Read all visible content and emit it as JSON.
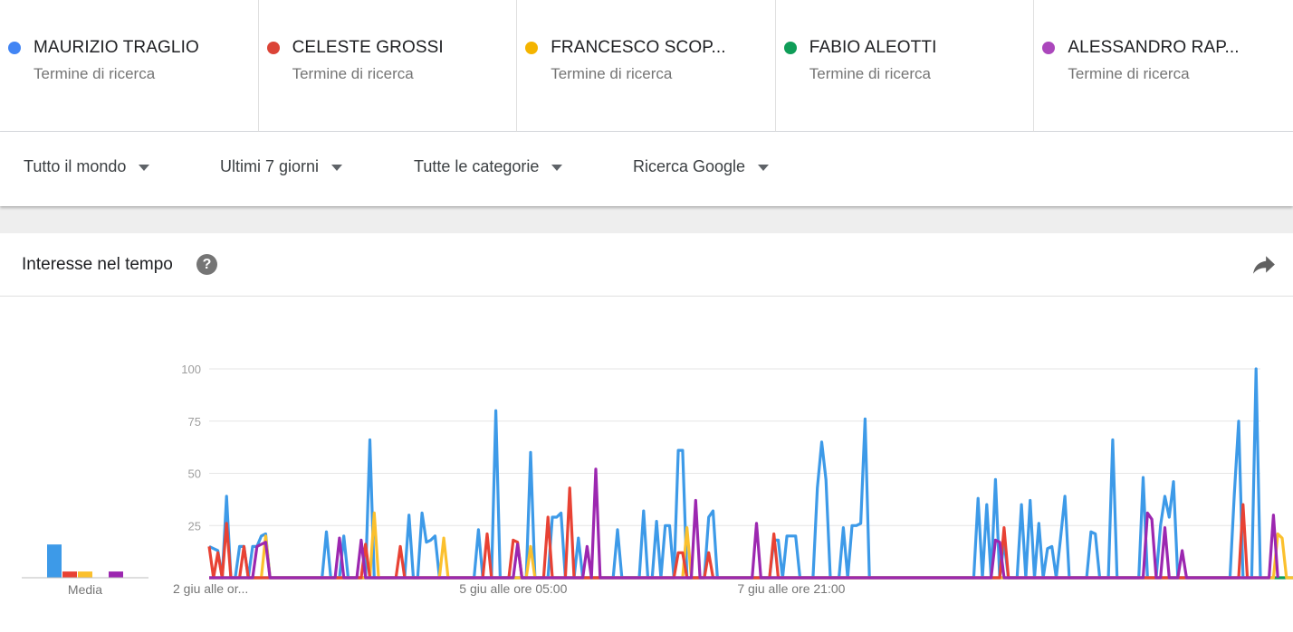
{
  "terms": [
    {
      "name": "MAURIZIO TRAGLIO",
      "subtitle": "Termine di ricerca",
      "color": "#4285f4"
    },
    {
      "name": "CELESTE GROSSI",
      "subtitle": "Termine di ricerca",
      "color": "#db4437"
    },
    {
      "name": "FRANCESCO SCOP...",
      "subtitle": "Termine di ricerca",
      "color": "#f4b400"
    },
    {
      "name": "FABIO ALEOTTI",
      "subtitle": "Termine di ricerca",
      "color": "#0f9d58"
    },
    {
      "name": "ALESSANDRO RAP...",
      "subtitle": "Termine di ricerca",
      "color": "#ab47bc"
    }
  ],
  "filters": {
    "region": "Tutto il mondo",
    "time": "Ultimi 7 giorni",
    "category": "Tutte le categorie",
    "property": "Ricerca Google"
  },
  "card": {
    "title": "Interesse nel tempo",
    "help_glyph": "?"
  },
  "chart_data": {
    "type": "line",
    "ylim": [
      0,
      100
    ],
    "y_ticks": [
      "100",
      "75",
      "50",
      "25"
    ],
    "x_labels": [
      {
        "label": "2 giu alle or...",
        "index": 0
      },
      {
        "label": "5 giu alle ore 05:00",
        "index": 70
      },
      {
        "label": "7 giu alle ore 21:00",
        "index": 134
      }
    ],
    "average_label": "Media",
    "averages": [
      {
        "name": "MAURIZIO TRAGLIO",
        "value": 16,
        "color": "#3d9ae8"
      },
      {
        "name": "CELESTE GROSSI",
        "value": 3,
        "color": "#e84234"
      },
      {
        "name": "FRANCESCO SCOP...",
        "value": 3,
        "color": "#fbc02d"
      },
      {
        "name": "FABIO ALEOTTI",
        "value": 0,
        "color": "#0f9d58"
      },
      {
        "name": "ALESSANDRO RAP...",
        "value": 3,
        "color": "#9c27b0"
      }
    ],
    "grid": true,
    "series": [
      {
        "name": "MAURIZIO TRAGLIO",
        "color": "#3d9ae8",
        "values": [
          15,
          14,
          13,
          0,
          39,
          0,
          0,
          15,
          15,
          0,
          15,
          15,
          20,
          21,
          0,
          0,
          0,
          0,
          0,
          0,
          0,
          0,
          0,
          0,
          0,
          0,
          0,
          22,
          0,
          0,
          0,
          20,
          0,
          0,
          0,
          0,
          0,
          66,
          0,
          0,
          0,
          0,
          0,
          0,
          0,
          0,
          30,
          0,
          0,
          31,
          17,
          18,
          20,
          0,
          0,
          0,
          0,
          0,
          0,
          0,
          0,
          0,
          23,
          0,
          0,
          0,
          80,
          0,
          0,
          0,
          0,
          0,
          0,
          0,
          60,
          0,
          0,
          0,
          0,
          29,
          29,
          31,
          0,
          0,
          0,
          19,
          0,
          0,
          0,
          0,
          0,
          0,
          0,
          0,
          23,
          0,
          0,
          0,
          0,
          0,
          32,
          0,
          0,
          27,
          0,
          25,
          25,
          0,
          61,
          61,
          0,
          0,
          0,
          0,
          0,
          29,
          32,
          0,
          0,
          0,
          0,
          0,
          0,
          0,
          0,
          0,
          0,
          0,
          0,
          0,
          18,
          18,
          0,
          20,
          20,
          20,
          0,
          0,
          0,
          0,
          43,
          65,
          47,
          0,
          0,
          0,
          24,
          0,
          25,
          25,
          26,
          76,
          0,
          0,
          0,
          0,
          0,
          0,
          0,
          0,
          0,
          0,
          0,
          0,
          0,
          0,
          0,
          0,
          0,
          0,
          0,
          0,
          0,
          0,
          0,
          0,
          0,
          38,
          0,
          35,
          0,
          47,
          0,
          17,
          0,
          0,
          0,
          35,
          0,
          37,
          0,
          26,
          0,
          14,
          15,
          0,
          19,
          39,
          0,
          0,
          0,
          0,
          0,
          22,
          21,
          0,
          0,
          0,
          66,
          0,
          0,
          0,
          0,
          0,
          0,
          48,
          0,
          0,
          0,
          25,
          39,
          29,
          46,
          0,
          0,
          0,
          0,
          0,
          0,
          0,
          0,
          0,
          0,
          0,
          0,
          0,
          40,
          75,
          0,
          0,
          0,
          100,
          0
        ]
      },
      {
        "name": "CELESTE GROSSI",
        "color": "#e84234",
        "values": [
          15,
          0,
          12,
          0,
          26,
          0,
          0,
          0,
          15,
          0,
          0,
          0,
          0,
          0,
          0,
          0,
          0,
          0,
          0,
          0,
          0,
          0,
          0,
          0,
          0,
          0,
          0,
          0,
          0,
          0,
          0,
          0,
          0,
          0,
          0,
          0,
          16,
          0,
          0,
          0,
          0,
          0,
          0,
          0,
          15,
          0,
          0,
          0,
          0,
          0,
          0,
          0,
          0,
          0,
          0,
          0,
          0,
          0,
          0,
          0,
          0,
          0,
          0,
          0,
          21,
          0,
          0,
          0,
          0,
          0,
          18,
          17,
          0,
          0,
          0,
          0,
          0,
          0,
          29,
          0,
          0,
          0,
          0,
          43,
          0,
          0,
          0,
          0,
          0,
          0,
          0,
          0,
          0,
          0,
          0,
          0,
          0,
          0,
          0,
          0,
          0,
          0,
          0,
          0,
          0,
          0,
          0,
          0,
          12,
          12,
          0,
          0,
          0,
          0,
          0,
          12,
          0,
          0,
          0,
          0,
          0,
          0,
          0,
          0,
          0,
          0,
          0,
          0,
          0,
          0,
          21,
          0,
          0,
          0,
          0,
          0,
          0,
          0,
          0,
          0,
          0,
          0,
          0,
          0,
          0,
          0,
          0,
          0,
          0,
          0,
          0,
          0,
          0,
          0,
          0,
          0,
          0,
          0,
          0,
          0,
          0,
          0,
          0,
          0,
          0,
          0,
          0,
          0,
          0,
          0,
          0,
          0,
          0,
          0,
          0,
          0,
          0,
          0,
          0,
          0,
          0,
          0,
          0,
          24,
          0,
          0,
          0,
          0,
          0,
          0,
          0,
          0,
          0,
          0,
          0,
          0,
          0,
          0,
          0,
          0,
          0,
          0,
          0,
          0,
          0,
          0,
          0,
          0,
          0,
          0,
          0,
          0,
          0,
          0,
          0,
          0,
          0,
          0,
          0,
          0,
          0,
          0,
          0,
          0,
          0,
          0,
          0,
          0,
          0,
          0,
          0,
          0,
          0,
          0,
          0,
          0,
          0,
          0,
          35,
          0
        ]
      },
      {
        "name": "FRANCESCO SCOP...",
        "color": "#fbc02d",
        "values": [
          0,
          0,
          0,
          0,
          0,
          0,
          0,
          0,
          0,
          0,
          0,
          0,
          0,
          20,
          0,
          0,
          0,
          0,
          0,
          0,
          0,
          0,
          0,
          0,
          0,
          0,
          0,
          0,
          0,
          0,
          0,
          0,
          0,
          0,
          0,
          0,
          0,
          0,
          31,
          0,
          0,
          0,
          0,
          0,
          0,
          0,
          0,
          0,
          0,
          0,
          0,
          0,
          0,
          0,
          19,
          0,
          0,
          0,
          0,
          0,
          0,
          0,
          0,
          0,
          0,
          0,
          0,
          0,
          0,
          0,
          0,
          0,
          0,
          0,
          15,
          0,
          0,
          0,
          0,
          0,
          0,
          0,
          0,
          0,
          0,
          0,
          0,
          0,
          0,
          0,
          0,
          0,
          0,
          0,
          0,
          0,
          0,
          0,
          0,
          0,
          0,
          0,
          0,
          0,
          0,
          0,
          0,
          0,
          0,
          0,
          24,
          0,
          0,
          0,
          0,
          0,
          0,
          0,
          0,
          0,
          0,
          0,
          0,
          0,
          0,
          0,
          0,
          0,
          0,
          0,
          0,
          0,
          0,
          0,
          0,
          0,
          0,
          0,
          0,
          0,
          0,
          0,
          0,
          0,
          0,
          0,
          0,
          0,
          0,
          0,
          0,
          0,
          0,
          0,
          0,
          0,
          0,
          0,
          0,
          0,
          0,
          0,
          0,
          0,
          0,
          0,
          0,
          0,
          0,
          0,
          0,
          0,
          0,
          0,
          0,
          0,
          0,
          0,
          0,
          0,
          0,
          0,
          0,
          0,
          0,
          0,
          0,
          0,
          0,
          0,
          0,
          0,
          0,
          0,
          0,
          0,
          0,
          0,
          0,
          0,
          0,
          0,
          0,
          0,
          0,
          0,
          0,
          0,
          0,
          0,
          0,
          0,
          0,
          0,
          0,
          0,
          0,
          0,
          0,
          0,
          0,
          0,
          0,
          0,
          0,
          0,
          0,
          0,
          0,
          0,
          0,
          0,
          0,
          0,
          0,
          0,
          0,
          0,
          0,
          0,
          0,
          0,
          0,
          0,
          0,
          0,
          21,
          19,
          0,
          0,
          0,
          0,
          0
        ]
      },
      {
        "name": "FABIO ALEOTTI",
        "color": "#0f9d58",
        "values": [
          0,
          0,
          0,
          0,
          0,
          0,
          0,
          0,
          0,
          0,
          0,
          0,
          0,
          0,
          0,
          0,
          0,
          0,
          0,
          0,
          0,
          0,
          0,
          0,
          0,
          0,
          0,
          0,
          0,
          0,
          0,
          0,
          0,
          0,
          0,
          0,
          0,
          0,
          0,
          0,
          0,
          0,
          0,
          0,
          0,
          0,
          0,
          0,
          0,
          0,
          0,
          0,
          0,
          0,
          0,
          0,
          0,
          0,
          0,
          0,
          0,
          0,
          0,
          0,
          0,
          0,
          0,
          0,
          0,
          0,
          0,
          0,
          0,
          0,
          0,
          0,
          0,
          0,
          0,
          0,
          0,
          0,
          0,
          0,
          0,
          0,
          0,
          0,
          0,
          0,
          0,
          0,
          0,
          0,
          0,
          0,
          0,
          0,
          0,
          0,
          0,
          0,
          0,
          0,
          0,
          0,
          0,
          0,
          0,
          0,
          0,
          0,
          0,
          0,
          0,
          0,
          0,
          0,
          0,
          0,
          0,
          0,
          0,
          0,
          0,
          0,
          0,
          0,
          0,
          0,
          0,
          0,
          0,
          0,
          0,
          0,
          0,
          0,
          0,
          0,
          0,
          0,
          0,
          0,
          0,
          0,
          0,
          0,
          0,
          0,
          0,
          0,
          0,
          0,
          0,
          0,
          0,
          0,
          0,
          0,
          0,
          0,
          0,
          0,
          0,
          0,
          0,
          0,
          0,
          0,
          0,
          0,
          0,
          0,
          0,
          0,
          0,
          0,
          0,
          0,
          0,
          0,
          0,
          0,
          0,
          0,
          0,
          0,
          0,
          0,
          0,
          0,
          0,
          0,
          0,
          0,
          0,
          0,
          0,
          0,
          0,
          0,
          0,
          0,
          0,
          0,
          0,
          0,
          0,
          0,
          0,
          0,
          0,
          0,
          0,
          0,
          0,
          0,
          0,
          0,
          0,
          0,
          0,
          0,
          0,
          0,
          0,
          0,
          0,
          0,
          0,
          0,
          0,
          0,
          0,
          0,
          0,
          0,
          0,
          0,
          0,
          0,
          0,
          0,
          0,
          0,
          0,
          0,
          0,
          0,
          0,
          0,
          0
        ]
      },
      {
        "name": "ALESSANDRO RAP...",
        "color": "#9c27b0",
        "values": [
          0,
          0,
          0,
          0,
          0,
          0,
          0,
          0,
          0,
          0,
          0,
          15,
          16,
          17,
          0,
          0,
          0,
          0,
          0,
          0,
          0,
          0,
          0,
          0,
          0,
          0,
          0,
          0,
          0,
          0,
          19,
          0,
          0,
          0,
          0,
          18,
          0,
          0,
          0,
          0,
          0,
          0,
          0,
          0,
          0,
          0,
          0,
          0,
          0,
          0,
          0,
          0,
          0,
          0,
          0,
          0,
          0,
          0,
          0,
          0,
          0,
          0,
          0,
          0,
          0,
          0,
          0,
          0,
          0,
          0,
          0,
          16,
          0,
          0,
          0,
          0,
          0,
          0,
          0,
          0,
          0,
          0,
          0,
          0,
          0,
          0,
          0,
          15,
          0,
          52,
          0,
          0,
          0,
          0,
          0,
          0,
          0,
          0,
          0,
          0,
          0,
          0,
          0,
          0,
          0,
          0,
          0,
          0,
          0,
          0,
          0,
          0,
          37,
          0,
          0,
          0,
          0,
          0,
          0,
          0,
          0,
          0,
          0,
          0,
          0,
          0,
          26,
          0,
          0,
          0,
          0,
          0,
          0,
          0,
          0,
          0,
          0,
          0,
          0,
          0,
          0,
          0,
          0,
          0,
          0,
          0,
          0,
          0,
          0,
          0,
          0,
          0,
          0,
          0,
          0,
          0,
          0,
          0,
          0,
          0,
          0,
          0,
          0,
          0,
          0,
          0,
          0,
          0,
          0,
          0,
          0,
          0,
          0,
          0,
          0,
          0,
          0,
          0,
          0,
          0,
          0,
          18,
          17,
          0,
          0,
          0,
          0,
          0,
          0,
          0,
          0,
          0,
          0,
          0,
          0,
          0,
          0,
          0,
          0,
          0,
          0,
          0,
          0,
          0,
          0,
          0,
          0,
          0,
          0,
          0,
          0,
          0,
          0,
          0,
          0,
          0,
          31,
          28,
          0,
          0,
          24,
          0,
          0,
          0,
          13,
          0,
          0,
          0,
          0,
          0,
          0,
          0,
          0,
          0,
          0,
          0,
          0,
          0,
          0,
          0,
          0,
          0,
          0,
          0,
          0,
          30,
          0
        ]
      }
    ]
  }
}
